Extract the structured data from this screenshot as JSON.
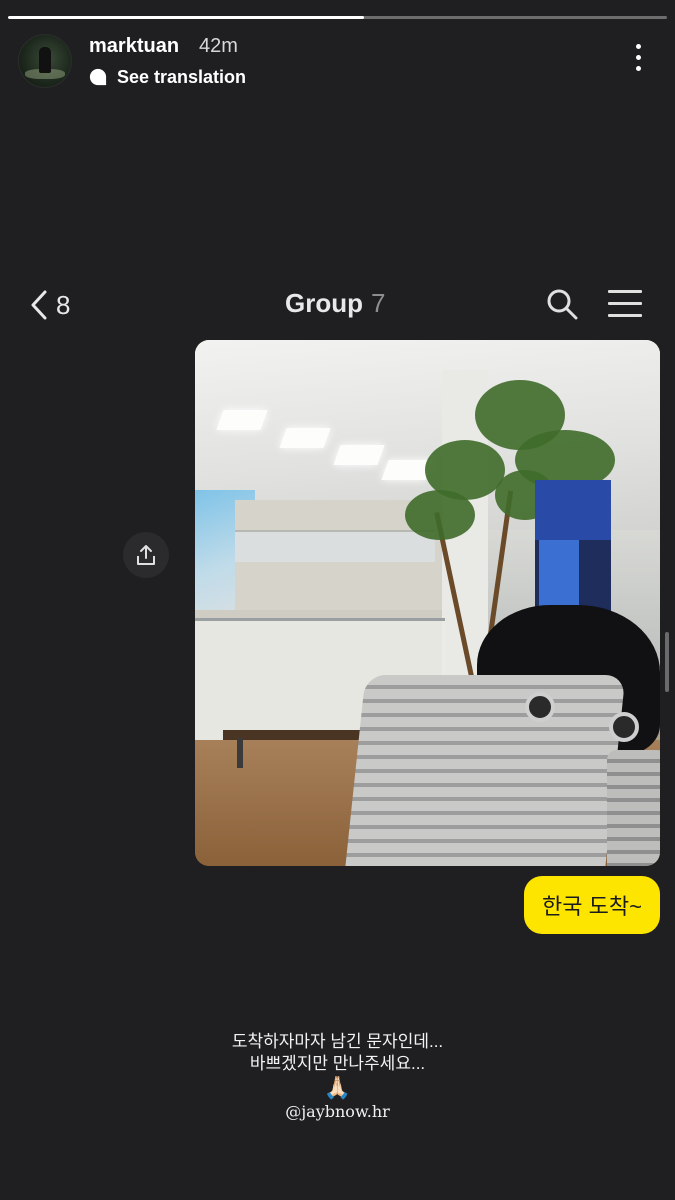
{
  "story": {
    "progress": 0.54,
    "username": "marktuan",
    "time_ago": "42m",
    "see_translation": "See translation",
    "avatar_icon": "avatar-image"
  },
  "chat": {
    "back_count": "8",
    "title": "Group",
    "member_count": "7",
    "message_bubble": "한국 도착~",
    "bubble_color": "#fee500"
  },
  "caption": {
    "line1": "도착하자마자 남긴 문자인데...",
    "line2": "바쁘겠지만 만나주세요...",
    "emoji": "🙏🏻",
    "mention": "@jaybnow.hr"
  }
}
